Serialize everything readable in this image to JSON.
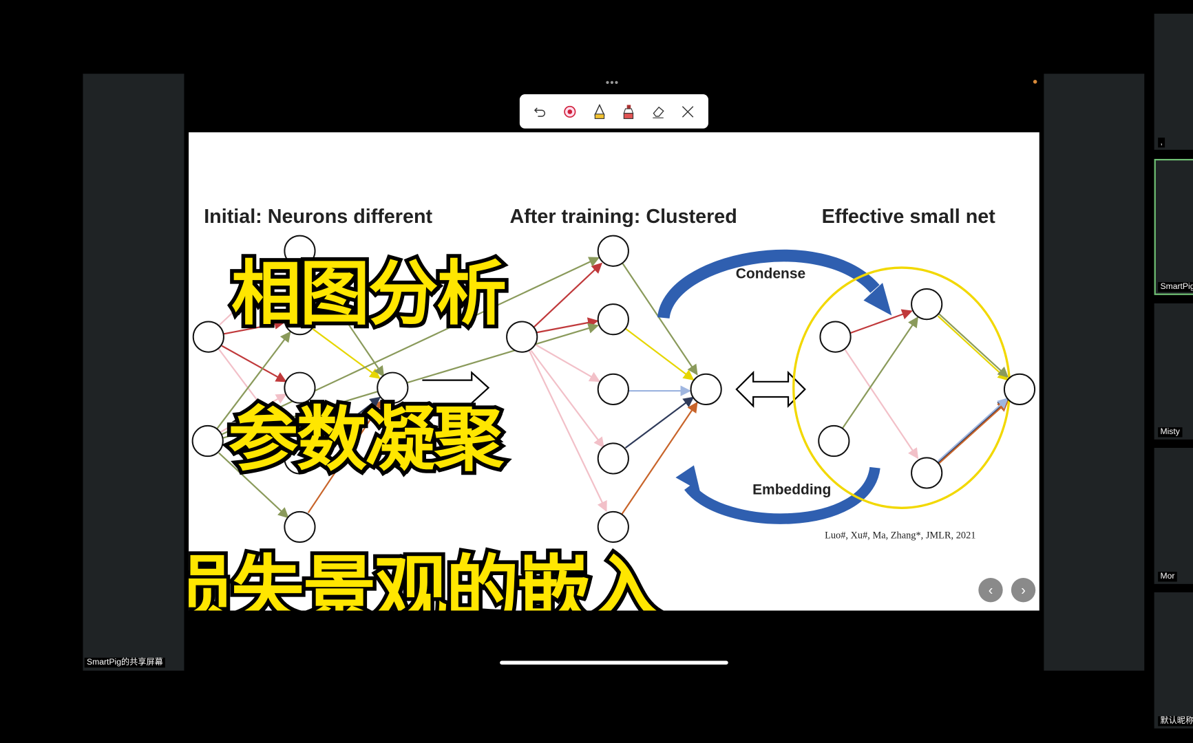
{
  "share_label": "SmartPig的共享屏幕",
  "toolbar": {
    "tools": [
      {
        "icon": "undo-icon"
      },
      {
        "icon": "laser-pointer-icon"
      },
      {
        "icon": "pen-icon"
      },
      {
        "icon": "highlighter-icon"
      },
      {
        "icon": "eraser-icon"
      },
      {
        "icon": "close-icon"
      }
    ]
  },
  "slide": {
    "headings": [
      "Initial: Neurons different",
      "After training: Clustered",
      "Effective small net"
    ],
    "condense_label": "Condense",
    "embedding_label": "Embedding",
    "citation": "Luo#, Xu#, Ma, Zhang*, JMLR, 2021",
    "overlay_lines": [
      "相图分析",
      "参数凝聚",
      "损失景观的嵌入"
    ]
  },
  "participants": [
    {
      "name": ","
    },
    {
      "name": "SmartPig",
      "active": true
    },
    {
      "name": "Misty"
    },
    {
      "name": "Mor"
    },
    {
      "name": "默认昵称"
    }
  ],
  "colors": {
    "overlay_text": "#ffe600",
    "active_border": "#6fbf73",
    "arrow_blue": "#2f5fb0",
    "ring_yellow": "#f2d800"
  }
}
